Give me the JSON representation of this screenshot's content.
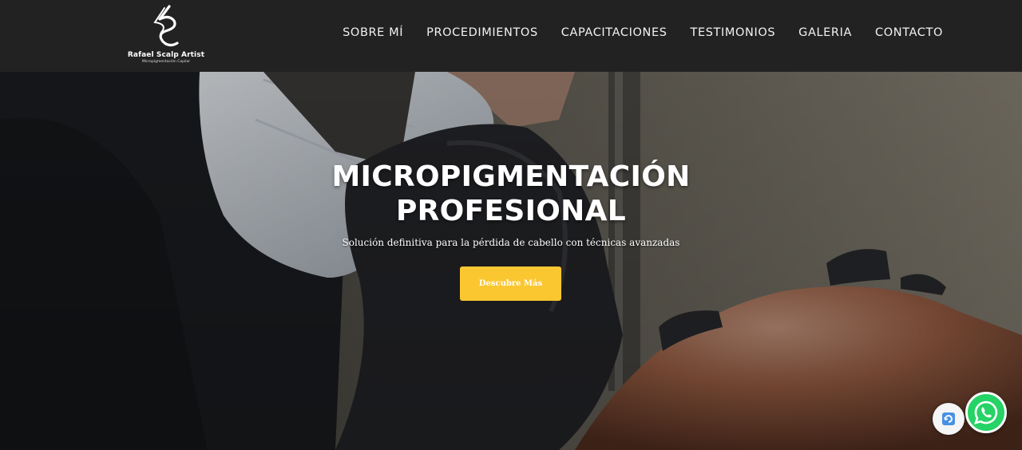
{
  "header": {
    "logo_name": "Rafael Scalp Artist",
    "logo_tagline": "Micropigmentación Capilar",
    "nav": [
      {
        "label": "SOBRE MÍ"
      },
      {
        "label": "PROCEDIMIENTOS"
      },
      {
        "label": "CAPACITACIONES"
      },
      {
        "label": "TESTIMONIOS"
      },
      {
        "label": "GALERIA"
      },
      {
        "label": "CONTACTO"
      }
    ]
  },
  "hero": {
    "title_line1": "MICROPIGMENTACIÓN",
    "title_line2": "PROFESIONAL",
    "subtitle": "Solución definitiva para la pérdida de cabello con técnicas avanzadas",
    "cta_label": "Descubre Más"
  },
  "floating": {
    "recaptcha_icon": "recaptcha-icon",
    "whatsapp_icon": "whatsapp-icon"
  },
  "colors": {
    "header_bg": "#222222",
    "cta_bg": "#fbc731",
    "whatsapp": "#25d366"
  }
}
